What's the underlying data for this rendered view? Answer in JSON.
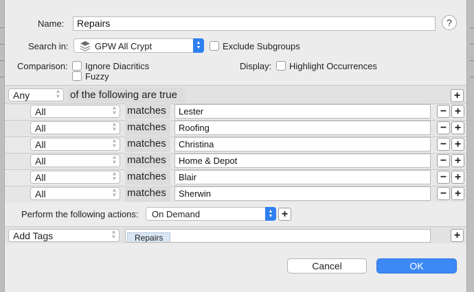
{
  "dialog": {
    "name_label": "Name:",
    "name_value": "Repairs",
    "help_label": "?",
    "search_in_label": "Search in:",
    "search_in_value": "GPW All Crypt",
    "exclude_subgroups_label": "Exclude Subgroups",
    "comparison_label": "Comparison:",
    "ignore_diacritics_label": "Ignore Diacritics",
    "fuzzy_label": "Fuzzy",
    "display_label": "Display:",
    "highlight_occurrences_label": "Highlight Occurrences"
  },
  "conditions": {
    "mode_value": "Any",
    "mode_suffix": "of the following are true",
    "add_label": "+",
    "remove_label": "−",
    "rows": [
      {
        "field": "All",
        "operator": "matches",
        "value": "Lester"
      },
      {
        "field": "All",
        "operator": "matches",
        "value": "Roofing"
      },
      {
        "field": "All",
        "operator": "matches",
        "value": "Christina"
      },
      {
        "field": "All",
        "operator": "matches",
        "value": "Home & Depot"
      },
      {
        "field": "All",
        "operator": "matches",
        "value": "Blair"
      },
      {
        "field": "All",
        "operator": "matches",
        "value": "Sherwin"
      }
    ]
  },
  "actions": {
    "perform_label": "Perform the following actions:",
    "perform_value": "On Demand",
    "add_label": "+",
    "action_type": "Add Tags",
    "tags": [
      "Repairs"
    ]
  },
  "buttons": {
    "cancel_label": "Cancel",
    "ok_label": "OK"
  },
  "colors": {
    "accent": "#3d8af7",
    "dialog_background": "#ececec"
  }
}
